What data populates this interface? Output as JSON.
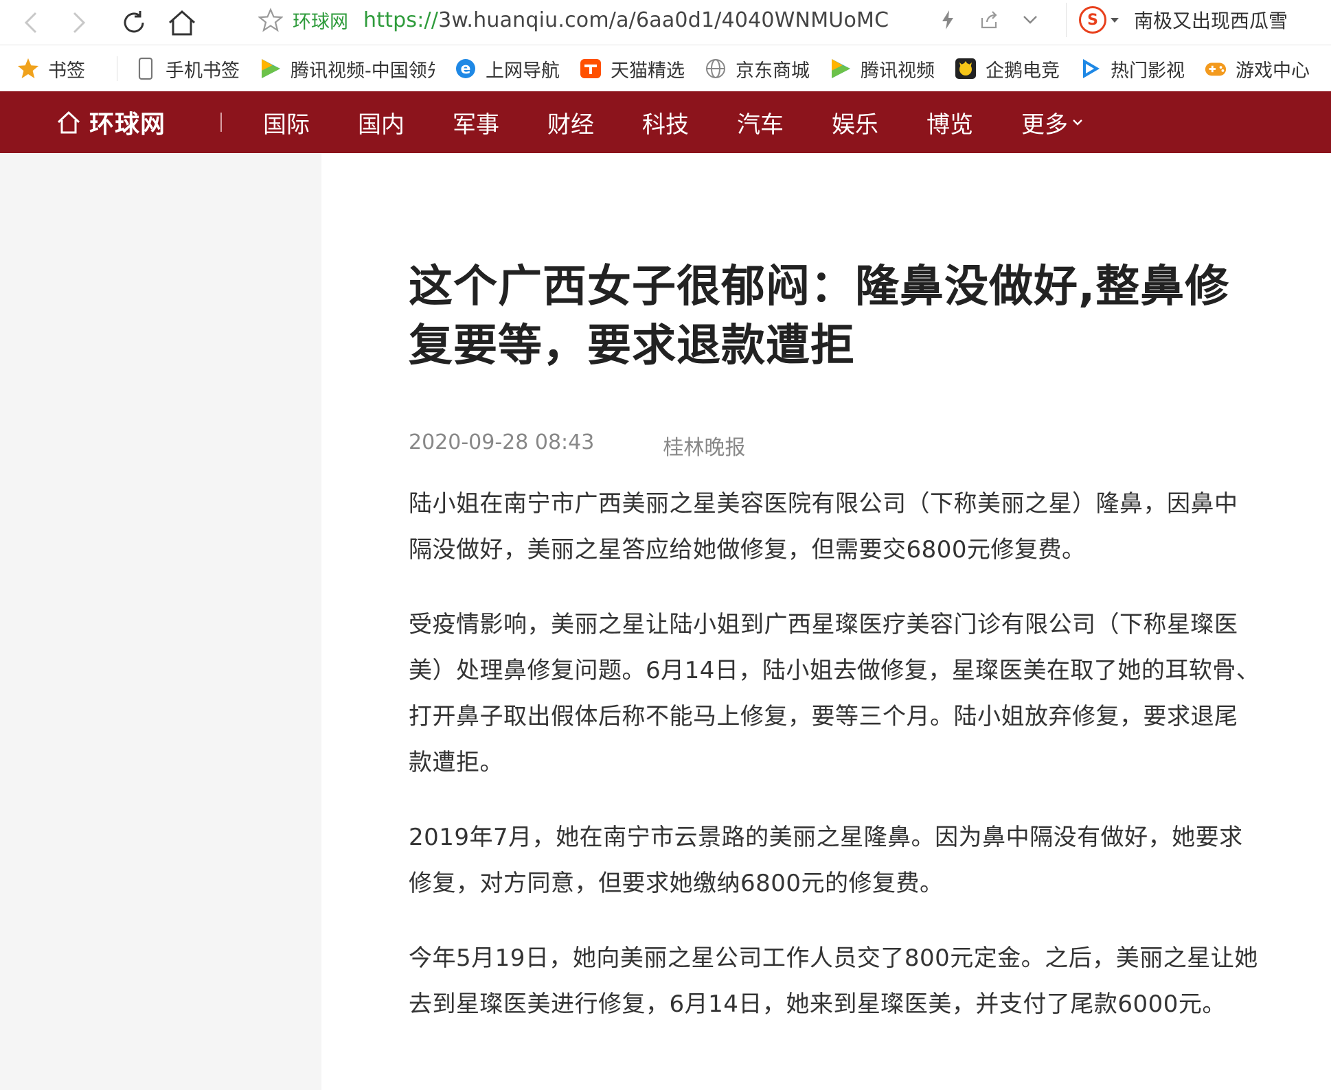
{
  "browser": {
    "site_name": "环球网",
    "url_scheme": "https://",
    "url_rest": "3w.huanqiu.com/a/6aa0d1/4040WNMUoMC",
    "search_text": "南极又出现西瓜雪"
  },
  "bookmarks": [
    {
      "label": "书签",
      "icon": "star-icon"
    },
    {
      "label": "手机书签",
      "icon": "phone-icon"
    },
    {
      "label": "腾讯视频-中国领先",
      "icon": "tencent-video-icon"
    },
    {
      "label": "上网导航",
      "icon": "ie-icon"
    },
    {
      "label": "天猫精选",
      "icon": "tmall-icon"
    },
    {
      "label": "京东商城",
      "icon": "globe-icon"
    },
    {
      "label": "腾讯视频",
      "icon": "tencent-video-icon"
    },
    {
      "label": "企鹅电竞",
      "icon": "penguin-esports-icon"
    },
    {
      "label": "热门影视",
      "icon": "video-play-icon"
    },
    {
      "label": "游戏中心",
      "icon": "gamepad-icon"
    }
  ],
  "site": {
    "logo_text": "环球网",
    "nav": [
      "国际",
      "国内",
      "军事",
      "财经",
      "科技",
      "汽车",
      "娱乐",
      "博览",
      "更多"
    ],
    "brand_color": "#8c141c"
  },
  "article": {
    "title": "这个广西女子很郁闷：隆鼻没做好,整鼻修复要等，要求退款遭拒",
    "date": "2020-09-28 08:43",
    "source": "桂林晚报",
    "paragraphs": [
      "陆小姐在南宁市广西美丽之星美容医院有限公司（下称美丽之星）隆鼻，因鼻中隔没做好，美丽之星答应给她做修复，但需要交6800元修复费。",
      "受疫情影响，美丽之星让陆小姐到广西星璨医疗美容门诊有限公司（下称星璨医美）处理鼻修复问题。6月14日，陆小姐去做修复，星璨医美在取了她的耳软骨、打开鼻子取出假体后称不能马上修复，要等三个月。陆小姐放弃修复，要求退尾款遭拒。",
      "2019年7月，她在南宁市云景路的美丽之星隆鼻。因为鼻中隔没有做好，她要求修复，对方同意，但要求她缴纳6800元的修复费。",
      "今年5月19日，她向美丽之星公司工作人员交了800元定金。之后，美丽之星让她去到星璨医美进行修复，6月14日，她来到星璨医美，并支付了尾款6000元。"
    ]
  }
}
